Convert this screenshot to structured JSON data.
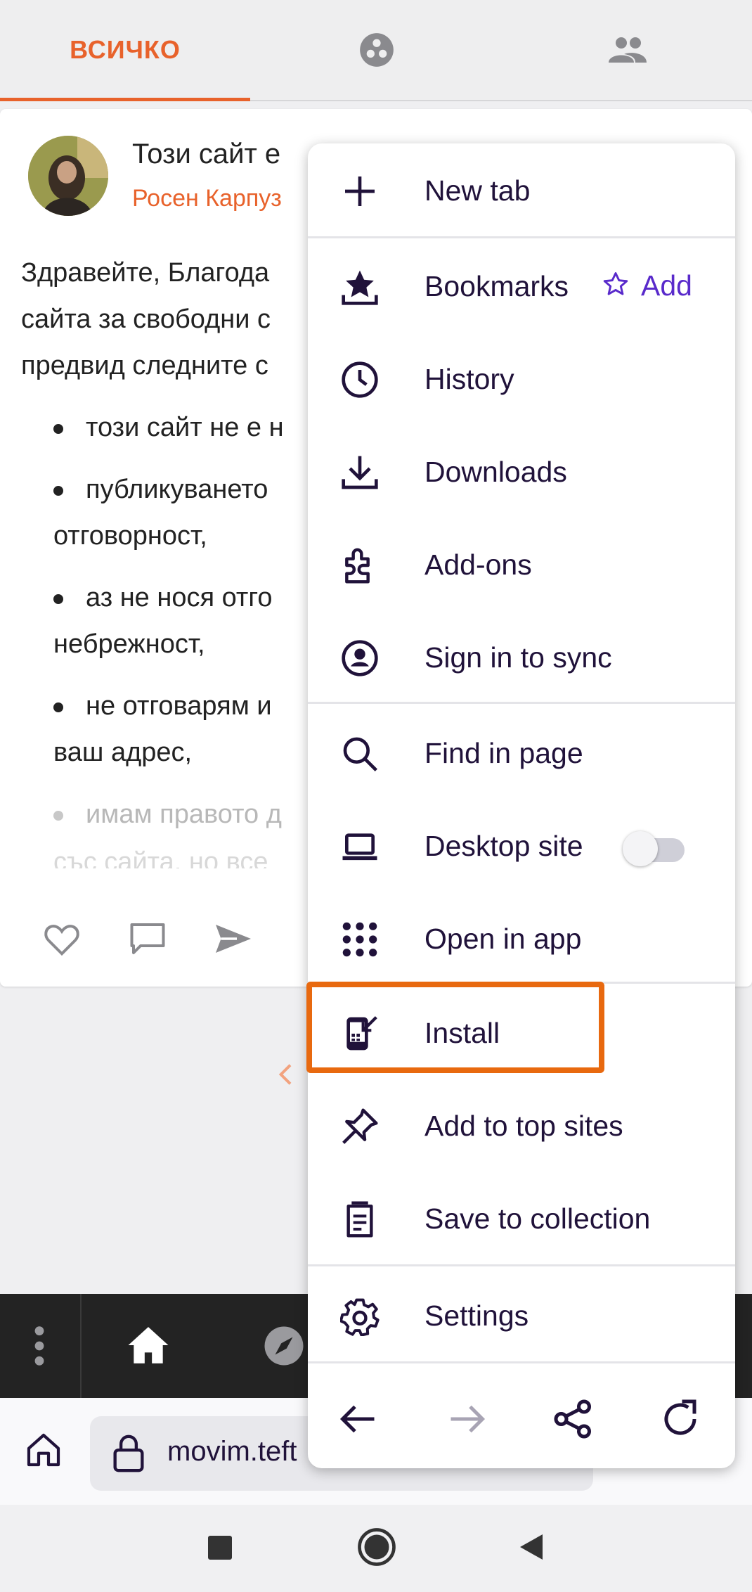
{
  "tabs": {
    "all_label": "ВСИЧКО",
    "communities_icon": "communities-icon",
    "contacts_icon": "people-icon"
  },
  "post": {
    "title": "Този сайт е",
    "author": "Росен Карпуз",
    "intro": "Здравейте, Благода сайта за свободни с предвид следните с",
    "intro_lines": [
      "Здравейте, Благода",
      "сайта за свободни с",
      "предвид следните с"
    ],
    "bullets": [
      [
        "този сайт не е н"
      ],
      [
        "публикуването",
        "отговорност,"
      ],
      [
        "аз не нося отго",
        "небрежност,"
      ],
      [
        "не отговарям и",
        "ваш адрес,"
      ],
      [
        "имам правото д"
      ]
    ],
    "faded_tail": "със сайта, но все"
  },
  "menu": {
    "items": [
      {
        "label": "New tab",
        "icon": "plus-icon"
      },
      {
        "label": "Bookmarks",
        "icon": "bookmark-star-icon",
        "extra": "Add"
      },
      {
        "label": "History",
        "icon": "clock-icon"
      },
      {
        "label": "Downloads",
        "icon": "download-icon"
      },
      {
        "label": "Add-ons",
        "icon": "puzzle-icon"
      },
      {
        "label": "Sign in to sync",
        "icon": "account-icon"
      },
      {
        "label": "Find in page",
        "icon": "search-icon"
      },
      {
        "label": "Desktop site",
        "icon": "laptop-icon",
        "toggle": false
      },
      {
        "label": "Open in app",
        "icon": "app-grid-icon"
      },
      {
        "label": "Install",
        "icon": "install-phone-icon"
      },
      {
        "label": "Add to top sites",
        "icon": "pin-icon"
      },
      {
        "label": "Save to collection",
        "icon": "collection-icon"
      },
      {
        "label": "Settings",
        "icon": "gear-icon"
      }
    ],
    "nav": [
      "back-arrow-icon",
      "forward-arrow-icon",
      "share-icon",
      "reload-icon"
    ]
  },
  "toolbar": {
    "url": "movim.teft"
  },
  "colors": {
    "accent": "#e8622b",
    "menu_text": "#20123a",
    "bookmark_add": "#592acb",
    "highlight": "#e8690f"
  }
}
